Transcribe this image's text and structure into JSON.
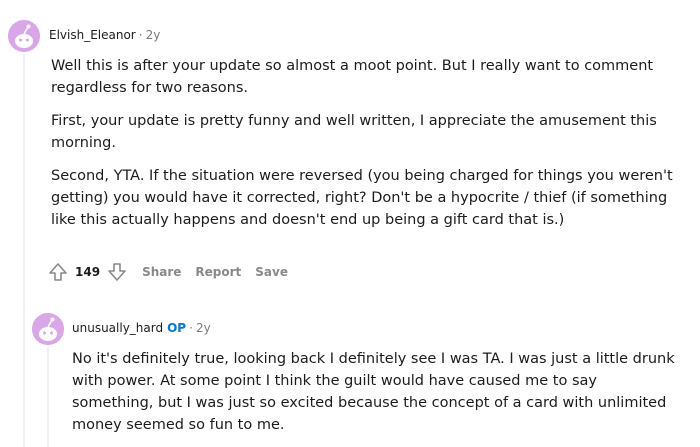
{
  "comment1": {
    "author": "Elvish_Eleanor",
    "age": "2y",
    "paragraphs": [
      "Well this is after your update so almost a moot point. But I really want to comment regardless for two reasons.",
      "First, your update is pretty funny and well written, I appreciate the amusement this morning.",
      "Second, YTA. If the situation were reversed (you being charged for things you weren't getting) you would have it corrected, right? Don't be a hypocrite / thief (if something like this actually happens and doesn't end up being a gift card that is.)"
    ],
    "score": "149",
    "actions": {
      "share": "Share",
      "report": "Report",
      "save": "Save"
    },
    "icons": {
      "avatar": "snoo-avatar-icon",
      "upvote": "upvote-arrow-icon",
      "downvote": "downvote-arrow-icon"
    }
  },
  "comment2": {
    "author": "unusually_hard",
    "badge": "OP",
    "age": "2y",
    "paragraphs": [
      "No it's definitely true, looking back I definitely see I was TA. I was just a little drunk with power. At some point I think the guilt would have caused me to say something, but I was just so excited because the concept of a card with unlimited money seemed so fun to me."
    ]
  },
  "separator": "·",
  "colors": {
    "op_badge": "#0079d3",
    "meta": "#7c7c7c",
    "actions": "#878a8c",
    "thread_line": "#edeff1",
    "avatar_bg": "#d9a7e8"
  }
}
